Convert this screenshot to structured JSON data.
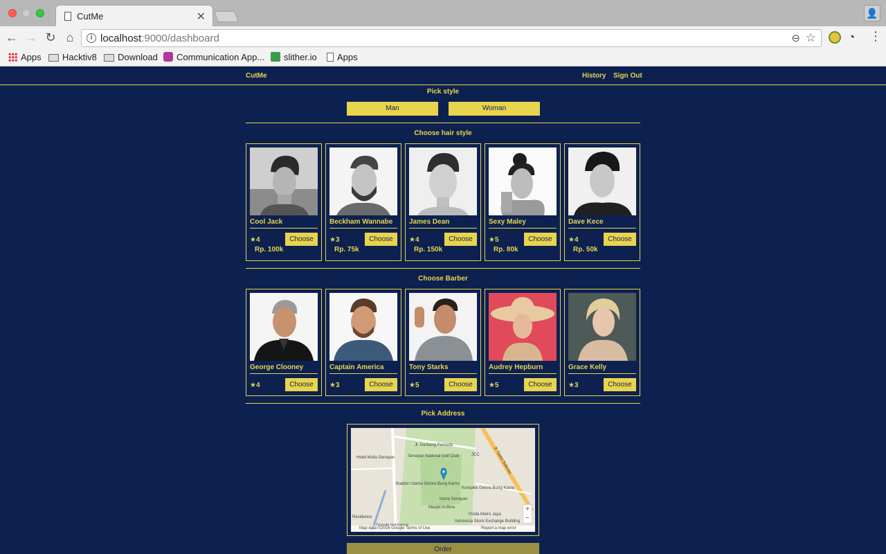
{
  "browser": {
    "tab_title": "CutMe",
    "url_host": "localhost",
    "url_path": ":9000/dashboard",
    "bookmarks": [
      "Apps",
      "Hacktiv8",
      "Download",
      "Communication App...",
      "slither.io",
      "Apps"
    ]
  },
  "nav": {
    "brand": "CutMe",
    "history": "History",
    "sign_out": "Sign Out"
  },
  "style": {
    "title": "Pick style",
    "man": "Man",
    "woman": "Woman"
  },
  "hair": {
    "title": "Choose hair style",
    "choose_label": "Choose",
    "items": [
      {
        "name": "Cool Jack",
        "rating": "★4",
        "price": "Rp. 100k"
      },
      {
        "name": "Beckham Wannabe",
        "rating": "★3",
        "price": "Rp. 75k"
      },
      {
        "name": "James Dean",
        "rating": "★4",
        "price": "Rp. 150k"
      },
      {
        "name": "Sexy Maley",
        "rating": "★5",
        "price": "Rp. 80k"
      },
      {
        "name": "Dave Kece",
        "rating": "★4",
        "price": "Rp. 50k"
      }
    ]
  },
  "barber": {
    "title": "Choose Barber",
    "choose_label": "Choose",
    "items": [
      {
        "name": "George Clooney",
        "rating": "★4"
      },
      {
        "name": "Captain America",
        "rating": "★3"
      },
      {
        "name": "Tony Starks",
        "rating": "★5"
      },
      {
        "name": "Audrey Hepburn",
        "rating": "★5"
      },
      {
        "name": "Grace Kelly",
        "rating": "★3"
      }
    ]
  },
  "address": {
    "title": "Pick Address",
    "map_labels": {
      "hotel": "Hotel Mulia Senayan",
      "golf": "Senayan National Golf Club",
      "jcc": "JCC",
      "stadium": "Stadion Utama Gelora Bung Karno",
      "komplek": "Komplek Gelora Bung Karno",
      "istora": "Istora Senayan",
      "masjid": "Masjid Al-Bina",
      "polda": "Polda Metro Jaya",
      "idx": "Indonesia Stock Exchange Building",
      "residence": "Residence",
      "google_id": "Google Indonesia",
      "gatot": "Jl. Gatot Subroto",
      "pemuda": "Jl. Gerbang Pemuda",
      "footer": "Map data ©2016 Google   Terms of Use",
      "report": "Report a map error"
    },
    "zoom_in": "+",
    "zoom_out": "−"
  },
  "order_label": "Order",
  "colors": {
    "accent": "#e8d44d",
    "background": "#0d2150",
    "order_button": "#9a9043"
  }
}
